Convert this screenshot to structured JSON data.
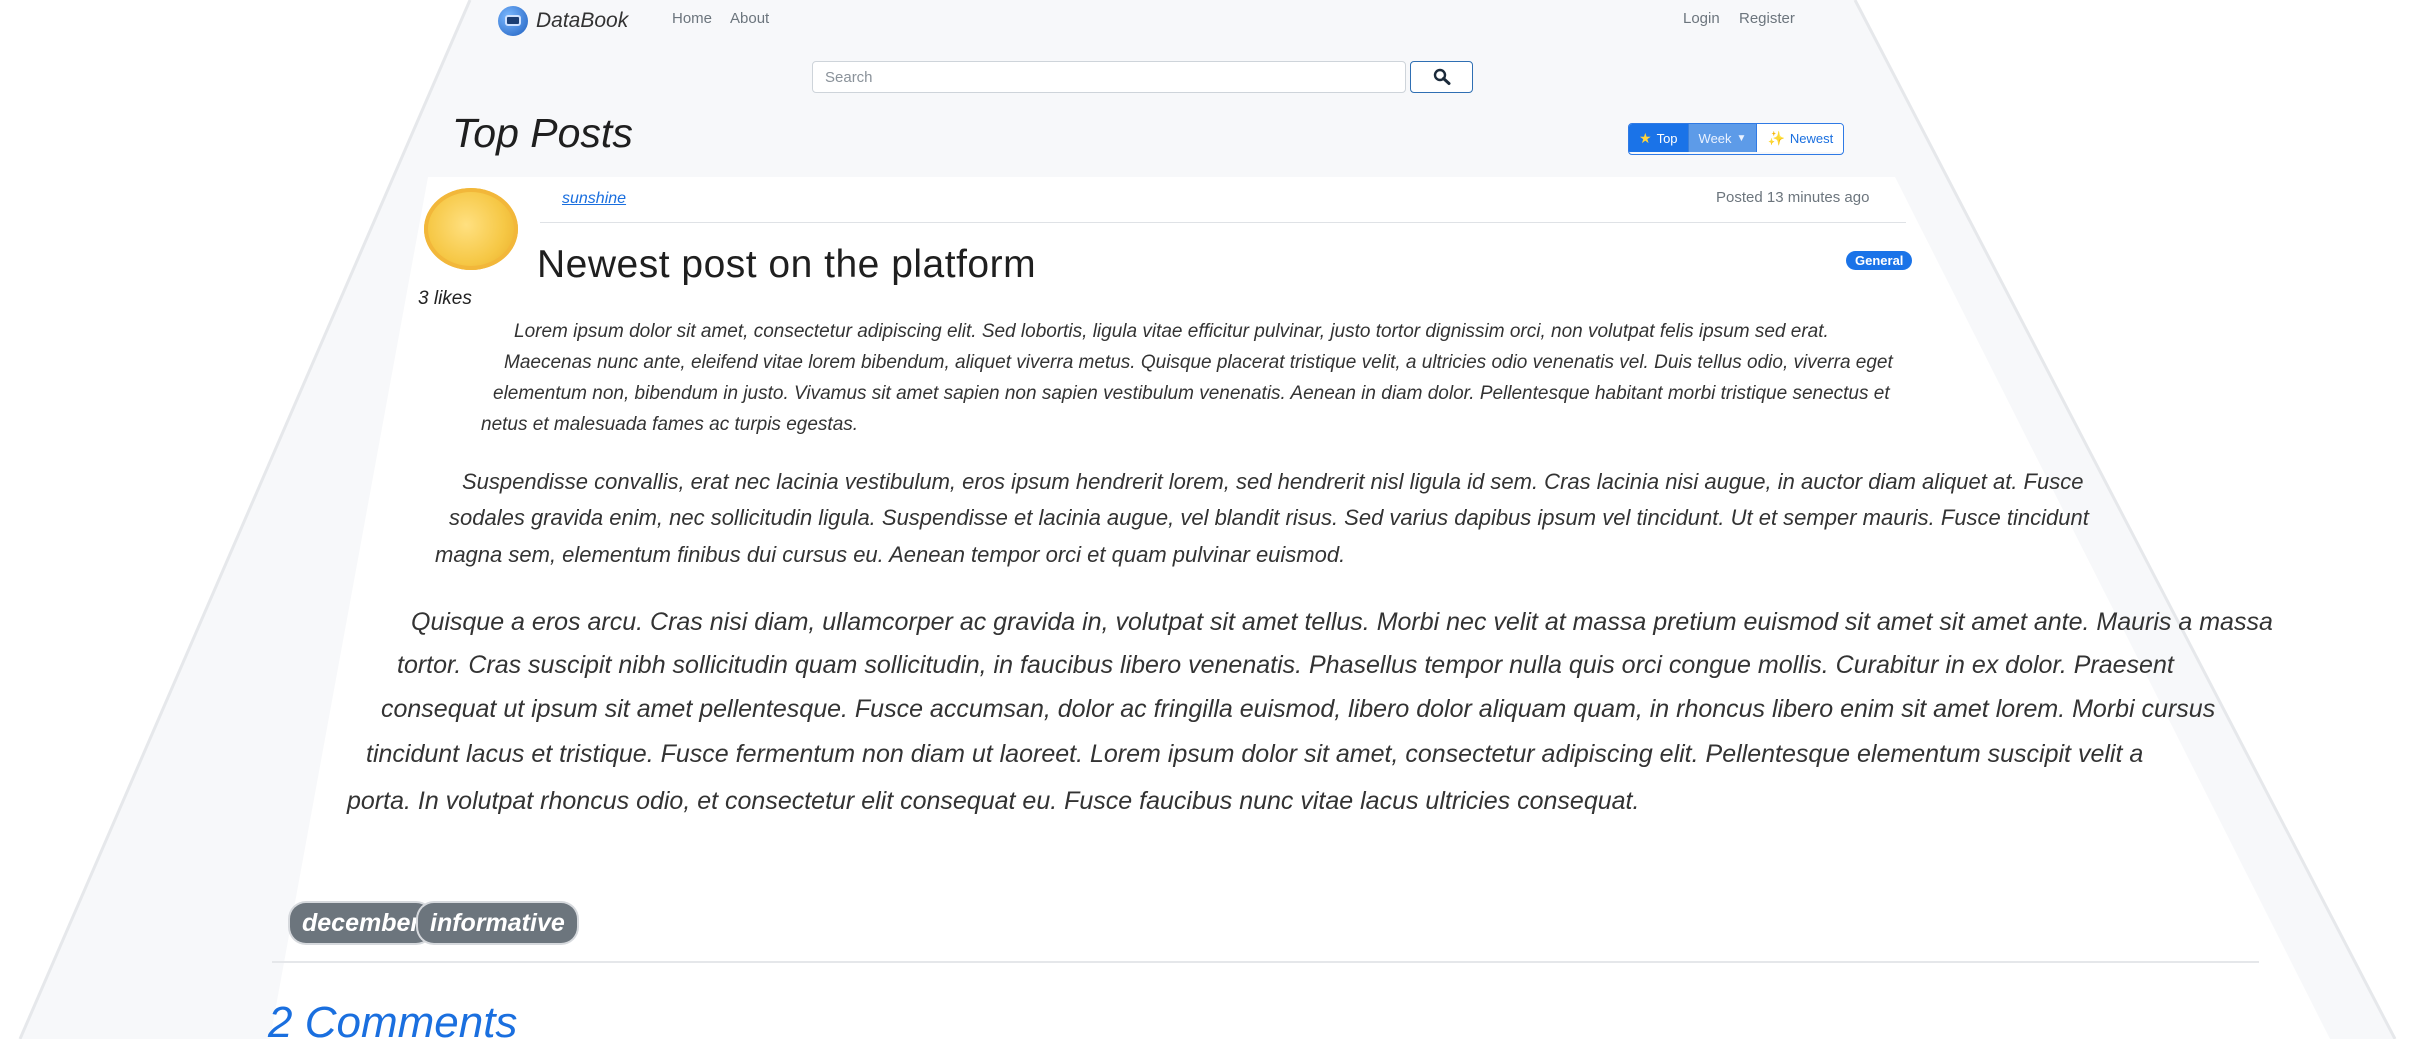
{
  "navbar": {
    "brand": "DataBook",
    "links": [
      "Home",
      "About"
    ],
    "auth_links": [
      "Login",
      "Register"
    ]
  },
  "search": {
    "placeholder": "Search"
  },
  "page": {
    "title": "Top Posts"
  },
  "sort": {
    "top_label": "Top",
    "period_label": "Week",
    "newest_label": "Newest"
  },
  "post": {
    "author": "sunshine",
    "posted": "Posted 13 minutes ago",
    "likes": "3 likes",
    "title": "Newest post on the platform",
    "category": "General",
    "paragraphs": [
      {
        "lines": [
          "Lorem ipsum dolor sit amet, consectetur adipiscing elit. Sed lobortis, ligula vitae efficitur pulvinar, justo tortor dignissim orci, non volutpat felis ipsum sed erat.",
          "Maecenas nunc ante, eleifend vitae lorem bibendum, aliquet viverra metus. Quisque placerat tristique velit, a ultricies odio venenatis vel. Duis tellus odio, viverra eget",
          "elementum non, bibendum in justo. Vivamus sit amet sapien non sapien vestibulum venenatis. Aenean in diam dolor. Pellentesque habitant morbi tristique senectus et",
          "netus et malesuada fames ac turpis egestas."
        ]
      },
      {
        "lines": [
          "Suspendisse convallis, erat nec lacinia vestibulum, eros ipsum hendrerit lorem, sed hendrerit nisl ligula id sem. Cras lacinia nisi augue, in auctor diam aliquet at. Fusce",
          "sodales gravida enim, nec sollicitudin ligula. Suspendisse et lacinia augue, vel blandit risus. Sed varius dapibus ipsum vel tincidunt. Ut et semper mauris. Fusce tincidunt",
          "magna sem, elementum finibus dui cursus eu. Aenean tempor orci et quam pulvinar euismod."
        ]
      },
      {
        "lines": [
          "Quisque a eros arcu. Cras nisi diam, ullamcorper ac gravida in, volutpat sit amet tellus. Morbi nec velit at massa pretium euismod sit amet sit amet ante. Mauris a massa",
          "tortor. Cras suscipit nibh sollicitudin quam sollicitudin, in faucibus libero venenatis. Phasellus tempor nulla quis orci congue mollis. Curabitur in ex dolor. Praesent",
          "consequat ut ipsum sit amet pellentesque. Fusce accumsan, dolor ac fringilla euismod, libero dolor aliquam quam, in rhoncus libero enim sit amet lorem. Morbi cursus",
          "tincidunt lacus et tristique. Fusce fermentum non diam ut laoreet. Lorem ipsum dolor sit amet, consectetur adipiscing elit. Pellentesque elementum suscipit velit a",
          "porta. In volutpat rhoncus odio, et consectetur elit consequat eu. Fusce faucibus nunc vitae lacus ultricies consequat."
        ]
      }
    ],
    "tags": [
      "december",
      "informative"
    ],
    "comments_heading": "2 Comments"
  },
  "icons": {
    "brand": "databook-logo-icon",
    "search": "search-icon",
    "top": "star-icon",
    "period": "chevron-down-icon",
    "newest": "sparkle-icon",
    "avatar": "sun-avatar"
  },
  "colors": {
    "accent": "#1a73e8",
    "tag_bg": "#6c757d",
    "page_bg": "#f7f8fa",
    "avatar": "#f6c846"
  }
}
